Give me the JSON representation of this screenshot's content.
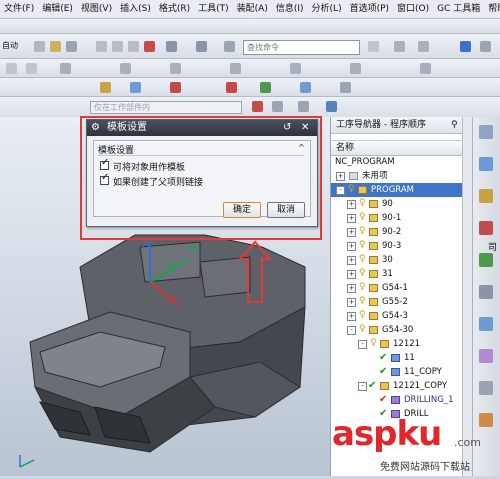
{
  "menu": [
    "文件(F)",
    "编辑(E)",
    "视图(V)",
    "插入(S)",
    "格式(R)",
    "工具(T)",
    "装配(A)",
    "信息(I)",
    "分析(L)",
    "首选项(P)",
    "窗口(O)",
    "GC 工具箱",
    "帮助(H)"
  ],
  "toolbar": {
    "left_label": "自动",
    "search_placeholder": "查找命令",
    "combo_value": "仅在工作部件内"
  },
  "dialog": {
    "title": "模板设置",
    "group": "模板设置",
    "options": [
      {
        "label": "可将对象用作模板",
        "checked": true
      },
      {
        "label": "如果创建了父项则链接",
        "checked": true
      }
    ],
    "ok": "确定",
    "cancel": "取消"
  },
  "axes": {
    "zc": "ZC",
    "ym": "YM",
    "yc": "YC",
    "xc": "XC"
  },
  "navigator": {
    "title": "工序导航器 - 程序顺序",
    "col_name": "名称",
    "root": "NC_PROGRAM",
    "unused": "未用项",
    "program": "PROGRAM",
    "items": [
      "90",
      "90-1",
      "90-2",
      "90-3",
      "30",
      "31",
      "G54-1",
      "G55-2",
      "G54-3",
      "G54-30",
      "12121",
      "11",
      "11_COPY",
      "12121_COPY",
      "DRILLING_1",
      "DRILL"
    ]
  },
  "side_text": "司",
  "watermark": {
    "brand": "aspku",
    "tld": ".com",
    "slogan": "免费网站源码下载站"
  },
  "colors": {
    "accent": "#3f74c6",
    "highlight": "#e23a3a",
    "dialog_title": "#2e323d"
  }
}
